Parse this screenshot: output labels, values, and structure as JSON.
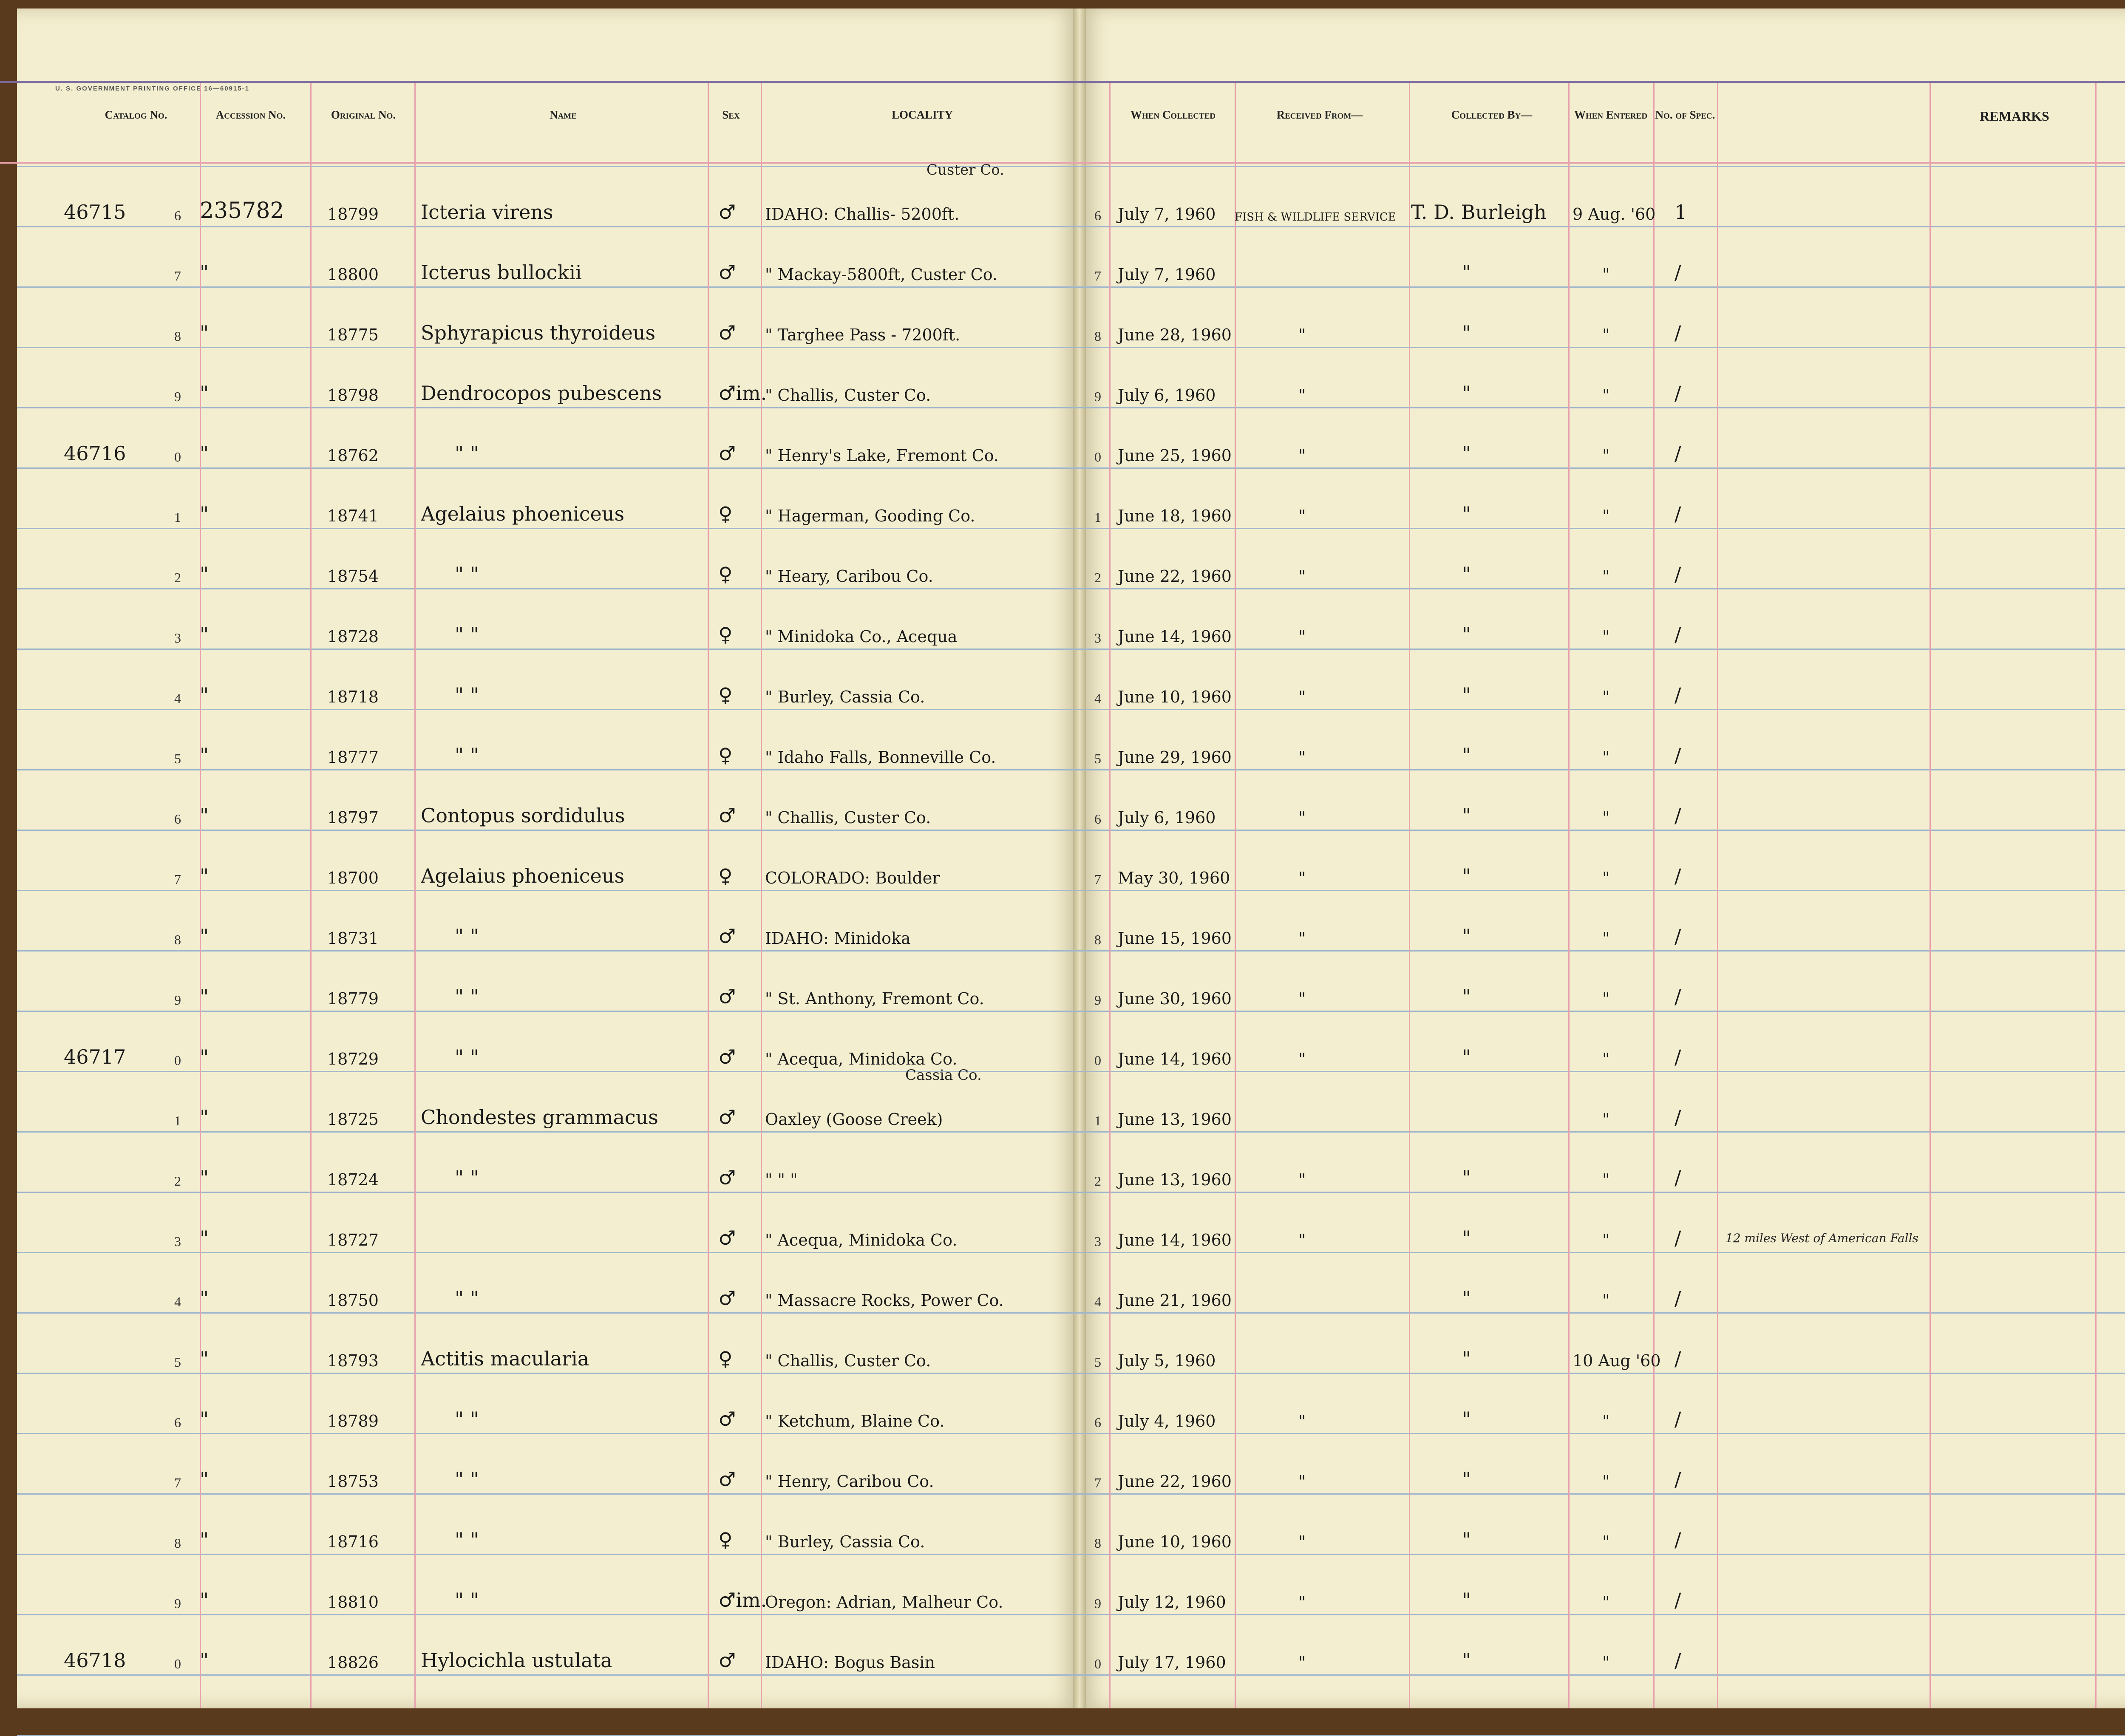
{
  "gpo_line": "U. S. GOVERNMENT PRINTING OFFICE   16—60915-1",
  "headers": {
    "catalog": "Catalog No.",
    "accession": "Accession No.",
    "original": "Original No.",
    "name": "Name",
    "sex": "Sex",
    "locality": "LOCALITY",
    "when_collected": "When Collected",
    "received_from": "Received From—",
    "collected_by": "Collected By—",
    "when_entered": "When Entered",
    "no_spec": "No. of Spec.",
    "remarks": "REMARKS"
  },
  "rows": [
    {
      "cat": "46715",
      "d": "6",
      "acc": "235782",
      "orig": "18799",
      "name": "Icteria virens",
      "sex": "♂",
      "loc": "IDAHO: Challis- 5200ft.",
      "loc_note": "Custer Co.",
      "rd": "6",
      "date": "July 7, 1960",
      "recv": "FISH & WILDLIFE SERVICE",
      "coll": "T. D. Burleigh",
      "entered": "9 Aug. '60",
      "spec": "1",
      "remark": ""
    },
    {
      "cat": "",
      "d": "7",
      "acc": "\"",
      "orig": "18800",
      "name": "Icterus bullockii",
      "sex": "♂",
      "loc": "\"     Mackay-5800ft, Custer Co.",
      "loc_note": "",
      "rd": "7",
      "date": "July 7, 1960",
      "recv": "",
      "coll": "\"",
      "entered": "\"",
      "spec": "/",
      "remark": ""
    },
    {
      "cat": "",
      "d": "8",
      "acc": "\"",
      "orig": "18775",
      "name": "Sphyrapicus thyroideus",
      "sex": "♂",
      "loc": "\"     Targhee Pass - 7200ft.",
      "loc_note": "",
      "rd": "8",
      "date": "June 28, 1960",
      "recv": "\"",
      "coll": "\"",
      "entered": "\"",
      "spec": "/",
      "remark": ""
    },
    {
      "cat": "",
      "d": "9",
      "acc": "\"",
      "orig": "18798",
      "name": "Dendrocopos pubescens",
      "sex": "♂im.",
      "loc": "\"     Challis, Custer Co.",
      "loc_note": "",
      "rd": "9",
      "date": "July 6, 1960",
      "recv": "\"",
      "coll": "\"",
      "entered": "\"",
      "spec": "/",
      "remark": ""
    },
    {
      "cat": "46716",
      "d": "0",
      "acc": "\"",
      "orig": "18762",
      "name": "\"          \"",
      "sex": "♂",
      "loc": "\"     Henry's Lake, Fremont Co.",
      "loc_note": "",
      "rd": "0",
      "date": "June 25, 1960",
      "recv": "\"",
      "coll": "\"",
      "entered": "\"",
      "spec": "/",
      "remark": ""
    },
    {
      "cat": "",
      "d": "1",
      "acc": "\"",
      "orig": "18741",
      "name": "Agelaius phoeniceus",
      "sex": "♀",
      "loc": "\"  Hagerman, Gooding Co.",
      "loc_note": "",
      "rd": "1",
      "date": "June 18, 1960",
      "recv": "\"",
      "coll": "\"",
      "entered": "\"",
      "spec": "/",
      "remark": ""
    },
    {
      "cat": "",
      "d": "2",
      "acc": "\"",
      "orig": "18754",
      "name": "\"          \"",
      "sex": "♀",
      "loc": "\"     Heary, Caribou Co.",
      "loc_note": "",
      "rd": "2",
      "date": "June 22, 1960",
      "recv": "\"",
      "coll": "\"",
      "entered": "\"",
      "spec": "/",
      "remark": ""
    },
    {
      "cat": "",
      "d": "3",
      "acc": "\"",
      "orig": "18728",
      "name": "\"          \"",
      "sex": "♀",
      "loc": "\"     Minidoka Co., Acequa",
      "loc_note": "",
      "rd": "3",
      "date": "June 14, 1960",
      "recv": "\"",
      "coll": "\"",
      "entered": "\"",
      "spec": "/",
      "remark": ""
    },
    {
      "cat": "",
      "d": "4",
      "acc": "\"",
      "orig": "18718",
      "name": "\"          \"",
      "sex": "♀",
      "loc": "\"     Burley, Cassia Co.",
      "loc_note": "",
      "rd": "4",
      "date": "June 10, 1960",
      "recv": "\"",
      "coll": "\"",
      "entered": "\"",
      "spec": "/",
      "remark": ""
    },
    {
      "cat": "",
      "d": "5",
      "acc": "\"",
      "orig": "18777",
      "name": "\"          \"",
      "sex": "♀",
      "loc": "\"  Idaho Falls, Bonneville Co.",
      "loc_note": "",
      "rd": "5",
      "date": "June 29, 1960",
      "recv": "\"",
      "coll": "\"",
      "entered": "\"",
      "spec": "/",
      "remark": ""
    },
    {
      "cat": "",
      "d": "6",
      "acc": "\"",
      "orig": "18797",
      "name": "Contopus sordidulus",
      "sex": "♂",
      "loc": "\"     Challis, Custer Co.",
      "loc_note": "",
      "rd": "6",
      "date": "July 6, 1960",
      "recv": "\"",
      "coll": "\"",
      "entered": "\"",
      "spec": "/",
      "remark": ""
    },
    {
      "cat": "",
      "d": "7",
      "acc": "\"",
      "orig": "18700",
      "name": "Agelaius phoeniceus",
      "sex": "♀",
      "loc": "COLORADO: Boulder",
      "loc_note": "",
      "rd": "7",
      "date": "May 30, 1960",
      "recv": "\"",
      "coll": "\"",
      "entered": "\"",
      "spec": "/",
      "remark": ""
    },
    {
      "cat": "",
      "d": "8",
      "acc": "\"",
      "orig": "18731",
      "name": "\"          \"",
      "sex": "♂",
      "loc": "IDAHO: Minidoka",
      "loc_note": "",
      "rd": "8",
      "date": "June 15, 1960",
      "recv": "\"",
      "coll": "\"",
      "entered": "\"",
      "spec": "/",
      "remark": ""
    },
    {
      "cat": "",
      "d": "9",
      "acc": "\"",
      "orig": "18779",
      "name": "\"          \"",
      "sex": "♂",
      "loc": "\"     St. Anthony, Fremont Co.",
      "loc_note": "",
      "rd": "9",
      "date": "June 30, 1960",
      "recv": "\"",
      "coll": "\"",
      "entered": "\"",
      "spec": "/",
      "remark": ""
    },
    {
      "cat": "46717",
      "d": "0",
      "acc": "\"",
      "orig": "18729",
      "name": "\"          \"",
      "sex": "♂",
      "loc": "\"     Acequa, Minidoka Co.",
      "loc_note": "",
      "rd": "0",
      "date": "June 14, 1960",
      "recv": "\"",
      "coll": "\"",
      "entered": "\"",
      "spec": "/",
      "remark": ""
    },
    {
      "cat": "",
      "d": "1",
      "acc": "\"",
      "orig": "18725",
      "name": "Chondestes grammacus",
      "sex": "♂",
      "loc": "Oaxley (Goose Creek)",
      "loc_note": "Cassia Co.",
      "rd": "1",
      "date": "June 13, 1960",
      "recv": "",
      "coll": "",
      "entered": "\"",
      "spec": "/",
      "remark": ""
    },
    {
      "cat": "",
      "d": "2",
      "acc": "\"",
      "orig": "18724",
      "name": "\"          \"",
      "sex": "♂",
      "loc": "\"         \"         \"",
      "loc_note": "",
      "rd": "2",
      "date": "June 13, 1960",
      "recv": "\"",
      "coll": "\"",
      "entered": "\"",
      "spec": "/",
      "remark": ""
    },
    {
      "cat": "",
      "d": "3",
      "acc": "\"",
      "orig": "18727",
      "name": "",
      "sex": "♂",
      "loc": "\"     Acequa, Minidoka Co.",
      "loc_note": "",
      "rd": "3",
      "date": "June 14, 1960",
      "recv": "\"",
      "coll": "\"",
      "entered": "\"",
      "spec": "/",
      "remark": ""
    },
    {
      "cat": "",
      "d": "4",
      "acc": "\"",
      "orig": "18750",
      "name": "\"          \"",
      "sex": "♂",
      "loc": "\"  Massacre Rocks, Power Co.",
      "loc_note": "",
      "rd": "4",
      "date": "June 21, 1960",
      "recv": "",
      "coll": "\"",
      "entered": "\"",
      "spec": "/",
      "remark": "12 miles West of American Falls"
    },
    {
      "cat": "",
      "d": "5",
      "acc": "\"",
      "orig": "18793",
      "name": "Actitis macularia",
      "sex": "♀",
      "loc": "\"     Challis, Custer Co.",
      "loc_note": "",
      "rd": "5",
      "date": "July 5, 1960",
      "recv": "",
      "coll": "\"",
      "entered": "10 Aug '60",
      "spec": "/",
      "remark": ""
    },
    {
      "cat": "",
      "d": "6",
      "acc": "\"",
      "orig": "18789",
      "name": "\"          \"",
      "sex": "♂",
      "loc": "\"     Ketchum, Blaine Co.",
      "loc_note": "",
      "rd": "6",
      "date": "July 4, 1960",
      "recv": "\"",
      "coll": "\"",
      "entered": "\"",
      "spec": "/",
      "remark": ""
    },
    {
      "cat": "",
      "d": "7",
      "acc": "\"",
      "orig": "18753",
      "name": "\"          \"",
      "sex": "♂",
      "loc": "\"     Henry, Caribou Co.",
      "loc_note": "",
      "rd": "7",
      "date": "June 22, 1960",
      "recv": "\"",
      "coll": "\"",
      "entered": "\"",
      "spec": "/",
      "remark": ""
    },
    {
      "cat": "",
      "d": "8",
      "acc": "\"",
      "orig": "18716",
      "name": "\"          \"",
      "sex": "♀",
      "loc": "\"     Burley, Cassia Co.",
      "loc_note": "",
      "rd": "8",
      "date": "June 10, 1960",
      "recv": "\"",
      "coll": "\"",
      "entered": "\"",
      "spec": "/",
      "remark": ""
    },
    {
      "cat": "",
      "d": "9",
      "acc": "\"",
      "orig": "18810",
      "name": "\"          \"",
      "sex": "♂im.",
      "loc": "Oregon: Adrian, Malheur Co.",
      "loc_note": "",
      "rd": "9",
      "date": "July 12, 1960",
      "recv": "\"",
      "coll": "\"",
      "entered": "\"",
      "spec": "/",
      "remark": ""
    },
    {
      "cat": "46718",
      "d": "0",
      "acc": "\"",
      "orig": "18826",
      "name": "Hylocichla ustulata",
      "sex": "♂",
      "loc": "IDAHO: Bogus Basin",
      "loc_note": "",
      "rd": "0",
      "date": "July 17, 1960",
      "recv": "\"",
      "coll": "\"",
      "entered": "\"",
      "spec": "/",
      "remark": ""
    }
  ]
}
